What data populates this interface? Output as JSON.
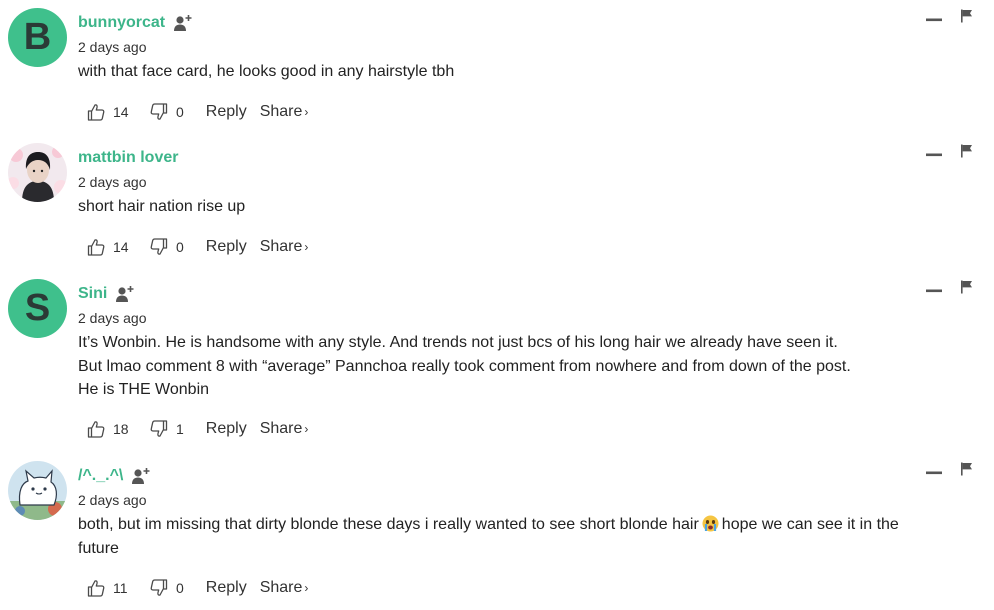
{
  "comments": [
    {
      "avatar_letter": "B",
      "username": "bunnyorcat",
      "has_follow": true,
      "timestamp": "2 days ago",
      "lines": [
        "with that face card, he looks good in any hairstyle tbh"
      ],
      "likes": "14",
      "dislikes": "0",
      "reply_label": "Reply",
      "share_label": "Share",
      "share_chevron": "›"
    },
    {
      "avatar_letter": "",
      "username": "mattbin lover",
      "has_follow": false,
      "timestamp": "2 days ago",
      "lines": [
        "short hair nation rise up"
      ],
      "likes": "14",
      "dislikes": "0",
      "reply_label": "Reply",
      "share_label": "Share",
      "share_chevron": "›"
    },
    {
      "avatar_letter": "S",
      "username": "Sini",
      "has_follow": true,
      "timestamp": "2 days ago",
      "lines": [
        "It’s Wonbin. He is handsome with any style. And trends not just bcs of his long hair we already have seen it.",
        "But lmao comment 8 with “average” Pannchoa really took comment from nowhere and from down of the post.",
        "He is THE Wonbin"
      ],
      "likes": "18",
      "dislikes": "1",
      "reply_label": "Reply",
      "share_label": "Share",
      "share_chevron": "›"
    },
    {
      "avatar_letter": "",
      "username": "/^._.^\\",
      "has_follow": true,
      "timestamp": "2 days ago",
      "text_before_emoji": "both, but im missing that dirty blonde these days i really wanted to see short blonde hair",
      "emoji": "crying-face-emoji",
      "text_after_emoji": "hope we can see it in the",
      "text_line2": "future",
      "likes": "11",
      "dislikes": "0",
      "reply_label": "Reply",
      "share_label": "Share",
      "share_chevron": "›"
    }
  ],
  "icons": {
    "follow": "add-user-icon",
    "like": "thumbs-up-icon",
    "dislike": "thumbs-down-icon",
    "collapse": "minus-icon",
    "report": "flag-icon"
  },
  "colors": {
    "username": "#3db58a",
    "avatar_bg": "#3fc08c",
    "text": "#222222",
    "icon": "#4a4a4a"
  }
}
